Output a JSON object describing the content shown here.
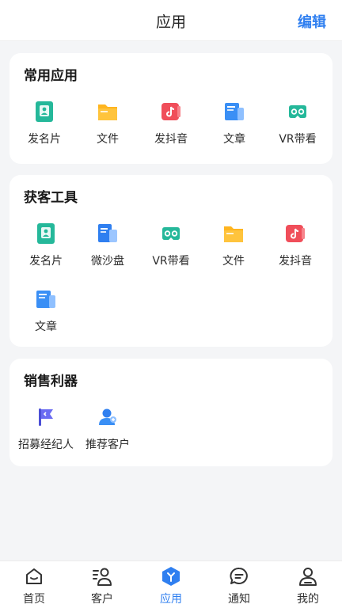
{
  "header": {
    "title": "应用",
    "edit_label": "编辑"
  },
  "sections": [
    {
      "heading": "常用应用",
      "items": [
        {
          "label": "发名片",
          "icon": "business-card-icon"
        },
        {
          "label": "文件",
          "icon": "folder-icon"
        },
        {
          "label": "发抖音",
          "icon": "douyin-icon"
        },
        {
          "label": "文章",
          "icon": "article-icon"
        },
        {
          "label": "VR带看",
          "icon": "vr-headset-icon"
        }
      ]
    },
    {
      "heading": "获客工具",
      "items": [
        {
          "label": "发名片",
          "icon": "business-card-icon"
        },
        {
          "label": "微沙盘",
          "icon": "sandbox-icon"
        },
        {
          "label": "VR带看",
          "icon": "vr-headset-icon"
        },
        {
          "label": "文件",
          "icon": "folder-icon"
        },
        {
          "label": "发抖音",
          "icon": "douyin-icon"
        },
        {
          "label": "文章",
          "icon": "article-icon"
        }
      ]
    },
    {
      "heading": "销售利器",
      "items": [
        {
          "label": "招募经纪人",
          "icon": "recruit-flag-icon"
        },
        {
          "label": "推荐客户",
          "icon": "recommend-customer-icon"
        }
      ]
    }
  ],
  "tabbar": [
    {
      "label": "首页",
      "icon": "home-icon",
      "active": false
    },
    {
      "label": "客户",
      "icon": "customers-icon",
      "active": false
    },
    {
      "label": "应用",
      "icon": "apps-icon",
      "active": true
    },
    {
      "label": "通知",
      "icon": "chat-bubble-icon",
      "active": false
    },
    {
      "label": "我的",
      "icon": "profile-icon",
      "active": false
    }
  ],
  "colors": {
    "accent": "#2f7ff0",
    "green": "#25b89a",
    "yellow": "#ffb51f",
    "red": "#f04e5a",
    "blue": "#3a8ff5",
    "purple": "#6b6cf2"
  }
}
